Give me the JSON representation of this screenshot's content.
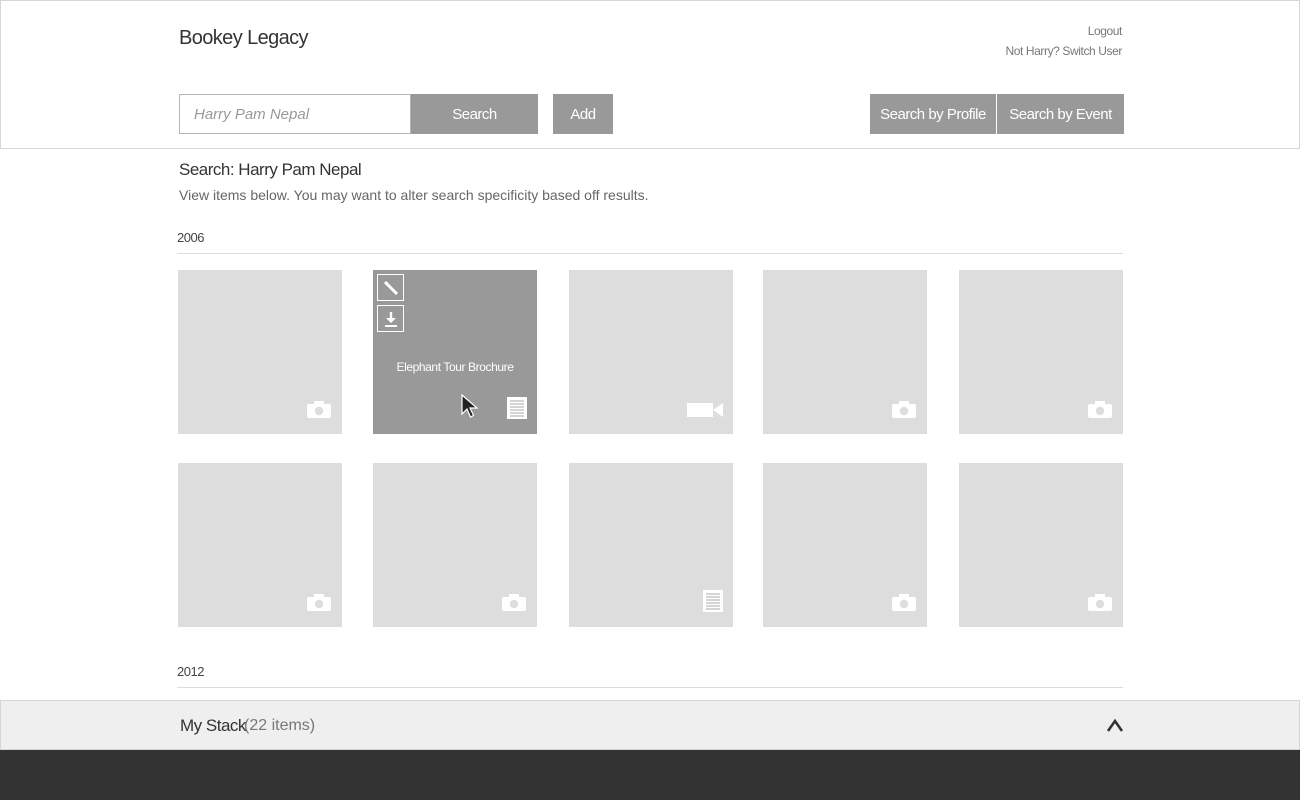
{
  "app": {
    "title": "Bookey Legacy"
  },
  "header": {
    "logout_label": "Logout",
    "switch_user_label": "Not Harry? Switch User"
  },
  "toolbar": {
    "search_value": "Harry Pam Nepal",
    "search_button": "Search",
    "add_button": "Add",
    "profile_button": "Search by Profile",
    "event_button": "Search by Event"
  },
  "results": {
    "title": "Search: Harry Pam Nepal",
    "subtitle": "View items below. You may want to alter search specificity based off results.",
    "groups": [
      {
        "year": "2006",
        "items": [
          {
            "type": "camera-icon"
          },
          {
            "type": "document-icon",
            "title": "Elephant Tour Brochure",
            "hover": true,
            "actions": [
              "edit-icon",
              "download-icon"
            ]
          },
          {
            "type": "video-icon"
          },
          {
            "type": "camera-icon"
          },
          {
            "type": "camera-icon"
          },
          {
            "type": "camera-icon"
          },
          {
            "type": "camera-icon"
          },
          {
            "type": "document-icon"
          },
          {
            "type": "camera-icon"
          },
          {
            "type": "camera-icon"
          }
        ]
      },
      {
        "year": "2012",
        "items": []
      }
    ]
  },
  "stack": {
    "title": "My Stack",
    "count": "(22 items)",
    "toggle_icon": "chevron-up-icon"
  },
  "colors": {
    "button": "#999999",
    "tile": "#dddddd",
    "footer": "#333333",
    "stack_bar": "#efefef"
  }
}
